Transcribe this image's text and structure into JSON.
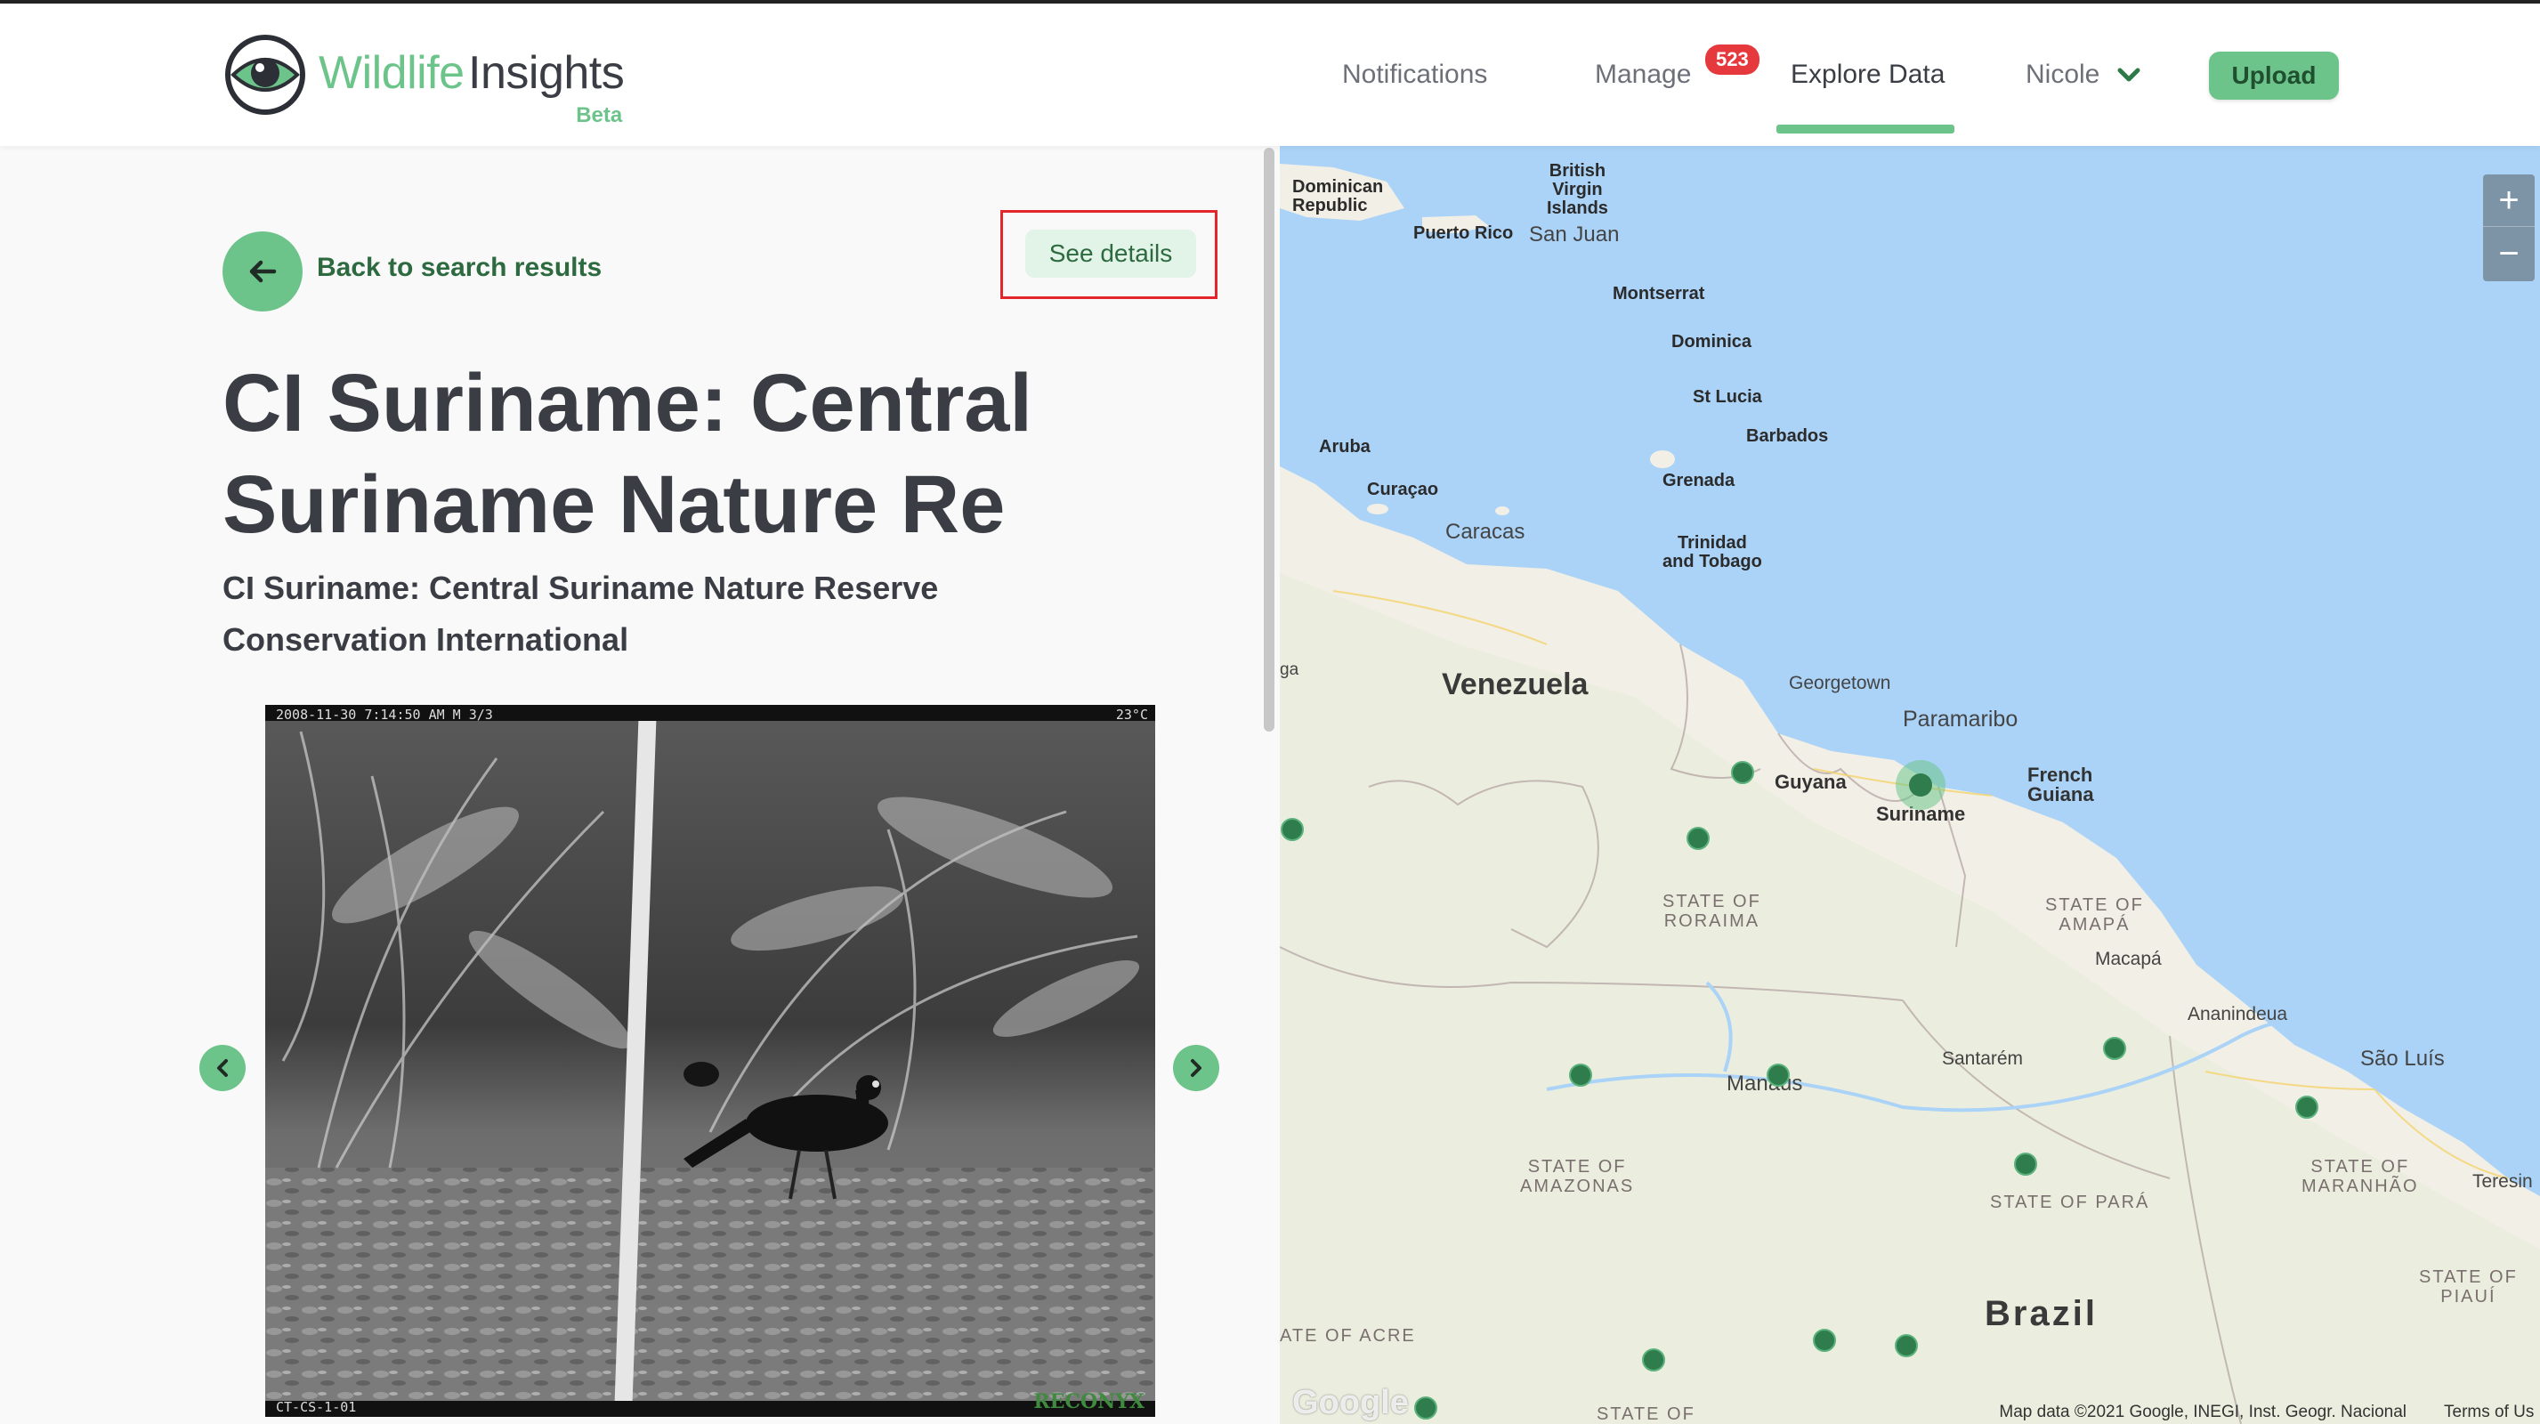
{
  "header": {
    "logo_word1": "Wildlife",
    "logo_word2": "Insights",
    "logo_beta": "Beta",
    "nav": {
      "notifications": "Notifications",
      "manage": "Manage",
      "manage_badge": "523",
      "explore": "Explore Data",
      "user": "Nicole"
    },
    "upload_label": "Upload"
  },
  "panel": {
    "back_label": "Back to search results",
    "details_label": "See details",
    "title": "CI Suriname: Central Suriname Nature Re",
    "subtitle": "CI Suriname: Central Suriname Nature Reserve",
    "organization": "Conservation International"
  },
  "photo": {
    "timestamp": "2008-11-30 7:14:50 AM  M 3/3",
    "temperature": "23°C",
    "camera_id": "CT-CS-1-01",
    "brand": "RECONYX"
  },
  "map": {
    "zoom_in": "+",
    "zoom_out": "−",
    "attribution": "Map data ©2021 Google, INEGI, Inst. Geogr. Nacional",
    "terms": "Terms of Us",
    "google_logo": "Google",
    "labels": {
      "dominican_republic": "Dominican\nRepublic",
      "bvi": "British\nVirgin\nIslands",
      "puerto_rico": "Puerto Rico",
      "san_juan": "San Juan",
      "montserrat": "Montserrat",
      "dominica": "Dominica",
      "st_lucia": "St Lucia",
      "barbados": "Barbados",
      "aruba": "Aruba",
      "curacao": "Curaçao",
      "grenada": "Grenada",
      "caracas": "Caracas",
      "trinidad": "Trinidad\nand Tobago",
      "venezuela": "Venezuela",
      "georgetown": "Georgetown",
      "paramaribo": "Paramaribo",
      "guyana": "Guyana",
      "suriname": "Suriname",
      "french_guiana": "French\nGuiana",
      "roraima": "STATE OF\nRORAIMA",
      "amapa": "STATE OF\nAMAPÁ",
      "macapa": "Macapá",
      "ananindeua": "Ananindeua",
      "santarem": "Santarém",
      "manaus": "Manaus",
      "sao_luis": "São Luís",
      "amazonas": "STATE OF\nAMAZONAS",
      "para": "STATE OF PARÁ",
      "maranhao": "STATE OF\nMARANHÃO",
      "teresina": "Teresin",
      "piaui": "STATE OF\nPIAUÍ",
      "brazil": "Brazil",
      "acre": "ATE OF ACRE",
      "state_of": "STATE OF",
      "ga": "ga"
    }
  }
}
